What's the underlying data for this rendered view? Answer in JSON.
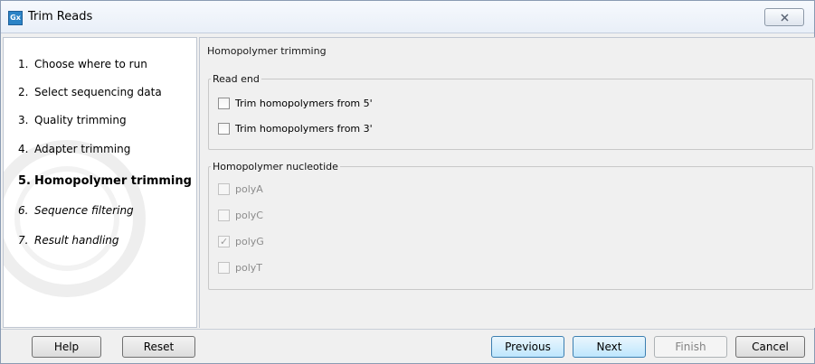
{
  "window": {
    "app_icon_text": "Gx",
    "title": "Trim Reads",
    "close_icon": "close-icon"
  },
  "steps": [
    {
      "number": "1.",
      "label": "Choose where to run",
      "state": "done"
    },
    {
      "number": "2.",
      "label": "Select sequencing data",
      "state": "done"
    },
    {
      "number": "3.",
      "label": "Quality trimming",
      "state": "done"
    },
    {
      "number": "4.",
      "label": "Adapter trimming",
      "state": "done"
    },
    {
      "number": "5.",
      "label": "Homopolymer trimming",
      "state": "current"
    },
    {
      "number": "6.",
      "label": "Sequence filtering",
      "state": "future"
    },
    {
      "number": "7.",
      "label": "Result handling",
      "state": "future"
    }
  ],
  "panel": {
    "title": "Homopolymer trimming",
    "read_end": {
      "legend": "Read end",
      "options": [
        {
          "label": "Trim homopolymers from 5'",
          "checked": false,
          "enabled": true
        },
        {
          "label": "Trim homopolymers from 3'",
          "checked": false,
          "enabled": true
        }
      ]
    },
    "nucleotide": {
      "legend": "Homopolymer nucleotide",
      "options": [
        {
          "label": "polyA",
          "checked": false,
          "enabled": false
        },
        {
          "label": "polyC",
          "checked": false,
          "enabled": false
        },
        {
          "label": "polyG",
          "checked": true,
          "enabled": false
        },
        {
          "label": "polyT",
          "checked": false,
          "enabled": false
        }
      ]
    }
  },
  "buttons": {
    "help": "Help",
    "reset": "Reset",
    "previous": "Previous",
    "next": "Next",
    "finish": "Finish",
    "cancel": "Cancel"
  },
  "colors": {
    "accent": "#3c7fb1",
    "app_icon": "#2b83c6",
    "disabled_text": "#8c8c8c"
  }
}
